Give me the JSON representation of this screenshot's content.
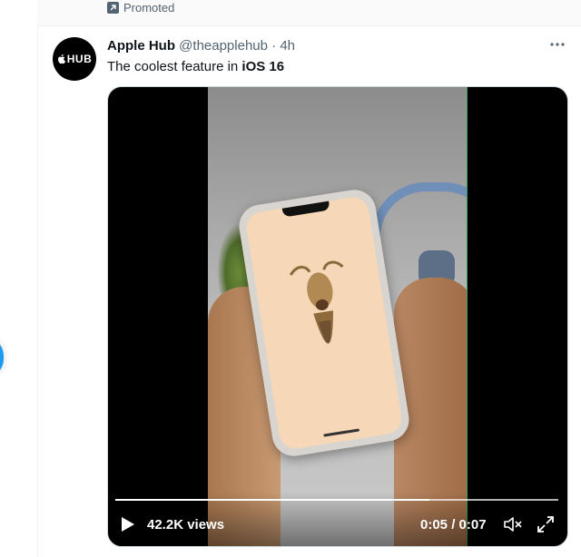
{
  "promoted": {
    "label": "Promoted",
    "icon": "promoted-arrow-icon"
  },
  "tweet": {
    "avatar_text": "HUB",
    "avatar_logo": "apple-logo-icon",
    "author": "Apple Hub",
    "handle": "@theapplehub",
    "separator": "·",
    "time": "4h",
    "text_prefix": "The coolest feature in ",
    "text_bold": "iOS 16",
    "more_icon": "more-dots-icon"
  },
  "video": {
    "views": "42.2K views",
    "timecode": "0:05 / 0:07",
    "progress": 0.71,
    "play_icon": "play-icon",
    "volume_icon": "volume-muted-icon",
    "fullscreen_icon": "fullscreen-icon"
  },
  "colors": {
    "accent": "#1d9bf0",
    "text_primary": "#0f1419",
    "text_secondary": "#536471"
  }
}
